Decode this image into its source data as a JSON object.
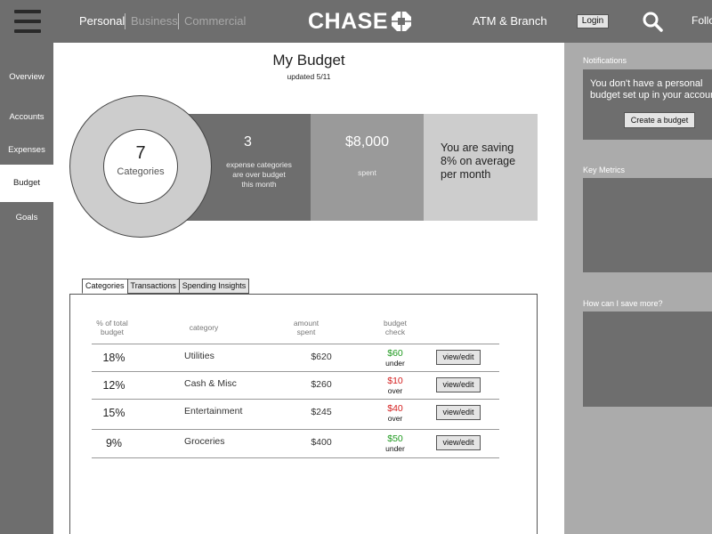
{
  "header": {
    "segments": [
      "Personal",
      "Business",
      "Commercial"
    ],
    "logo_text": "CHASE",
    "atm_branch": "ATM & Branch",
    "login_label": "Login",
    "follow_label": "Follow"
  },
  "nav": {
    "items": [
      {
        "label": "Overview"
      },
      {
        "label": "Accounts"
      },
      {
        "label": "Expenses"
      },
      {
        "label": "Budget"
      },
      {
        "label": "Goals"
      }
    ],
    "active": "Budget"
  },
  "page": {
    "title": "My Budget",
    "updated": "updated 5/11"
  },
  "summary": {
    "categories_count": "7",
    "categories_label": "Categories",
    "over_count": "3",
    "over_text": "expense categories are over budget this month",
    "spent_amount": "$8,000",
    "spent_label": "spent",
    "saving_text": "You are saving 8% on average per month"
  },
  "tabs": [
    "Categories",
    "Transactions",
    "Spending Insights"
  ],
  "table": {
    "headers": [
      "% of total budget",
      "category",
      "amount spent",
      "budget check"
    ],
    "rows": [
      {
        "pct": "18%",
        "category": "Utilities",
        "amount": "$620",
        "check_amount": "$60",
        "check_label": "under",
        "status": "under",
        "action": "view/edit"
      },
      {
        "pct": "12%",
        "category": "Cash & Misc",
        "amount": "$260",
        "check_amount": "$10",
        "check_label": "over",
        "status": "over",
        "action": "view/edit"
      },
      {
        "pct": "15%",
        "category": "Entertainment",
        "amount": "$245",
        "check_amount": "$40",
        "check_label": "over",
        "status": "over",
        "action": "view/edit"
      },
      {
        "pct": "9%",
        "category": "Groceries",
        "amount": "$400",
        "check_amount": "$50",
        "check_label": "under",
        "status": "under",
        "action": "view/edit"
      }
    ]
  },
  "sidebar": {
    "notifications_label": "Notifications",
    "notification_text": "You don't have a personal budget set up in your account",
    "create_budget_label": "Create a budget",
    "key_metrics_label": "Key Metrics",
    "save_more_label": "How can I save more?"
  },
  "colors": {
    "bar": "#6e6e6e",
    "sidebar": "#ababab",
    "under": "#1f9a1f",
    "over": "#d42020"
  },
  "icons": {
    "menu": "menu-icon",
    "search": "search-icon",
    "logo": "chase-octagon-icon"
  }
}
